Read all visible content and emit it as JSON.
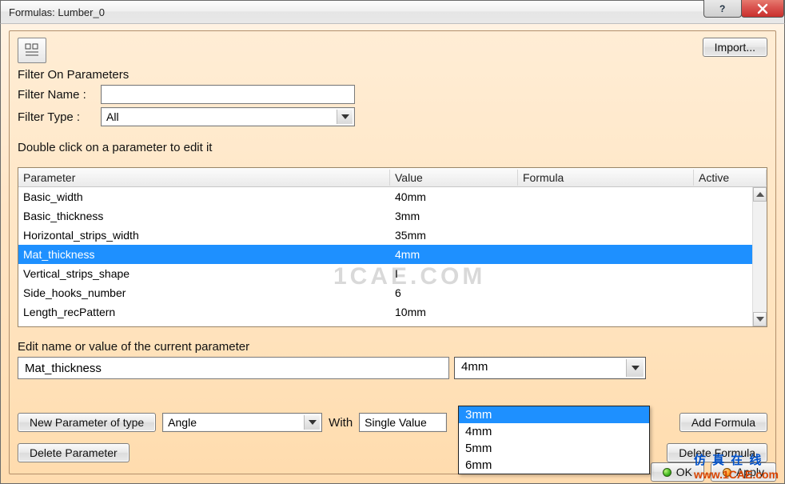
{
  "window": {
    "title": "Formulas: Lumber_0"
  },
  "toolbar": {
    "import": "Import..."
  },
  "filters": {
    "heading": "Filter On Parameters",
    "name_label": "Filter Name :",
    "name_value": "",
    "type_label": "Filter Type :",
    "type_value": "All"
  },
  "table": {
    "hint": "Double click on a parameter to edit it",
    "headers": {
      "parameter": "Parameter",
      "value": "Value",
      "formula": "Formula",
      "active": "Active"
    },
    "rows": [
      {
        "parameter": "Basic_width",
        "value": "40mm",
        "formula": "",
        "active": "",
        "selected": false
      },
      {
        "parameter": "Basic_thickness",
        "value": "3mm",
        "formula": "",
        "active": "",
        "selected": false
      },
      {
        "parameter": "Horizontal_strips_width",
        "value": "35mm",
        "formula": "",
        "active": "",
        "selected": false
      },
      {
        "parameter": "Mat_thickness",
        "value": "4mm",
        "formula": "",
        "active": "",
        "selected": true
      },
      {
        "parameter": "Vertical_strips_shape",
        "value": "I",
        "formula": "",
        "active": "",
        "selected": false
      },
      {
        "parameter": "Side_hooks_number",
        "value": "6",
        "formula": "",
        "active": "",
        "selected": false
      },
      {
        "parameter": "Length_recPattern",
        "value": "10mm",
        "formula": "",
        "active": "",
        "selected": false
      }
    ]
  },
  "edit": {
    "heading": "Edit name or value of the current parameter",
    "name": "Mat_thickness",
    "value": "4mm",
    "options": [
      "3mm",
      "4mm",
      "5mm",
      "6mm"
    ],
    "highlight_index": 0
  },
  "newparam": {
    "button": "New Parameter of type",
    "type": "Angle",
    "with_label": "With",
    "with_value": "Single Value"
  },
  "buttons": {
    "add_formula": "Add Formula",
    "delete_parameter": "Delete Parameter",
    "delete_formula": "Delete Formula",
    "ok": "OK",
    "apply": "Apply"
  },
  "watermark": {
    "text": "1CAE.COM"
  },
  "brand": {
    "cn": "仿 真 在 线",
    "url": "www.1CAE.com"
  }
}
